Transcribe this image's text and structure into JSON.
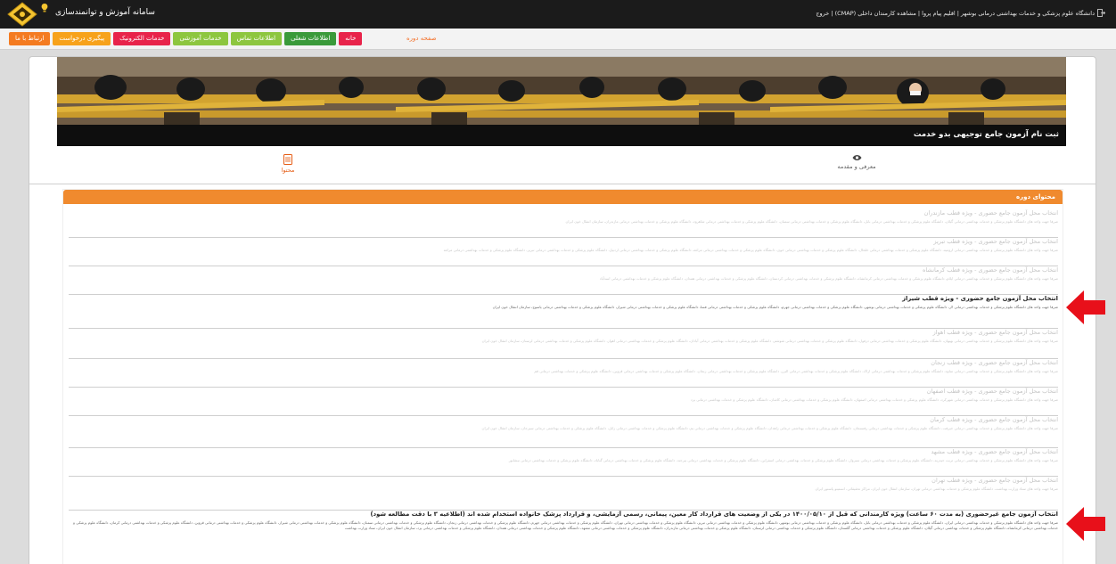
{
  "topbar": {
    "app_title": "سامانه آموزش و توانمندسازی",
    "user_info": "دانشگاه علوم پزشکی و خدمات بهداشتی درمانی بوشهر | اقلیم پیام پروا | مشاهده کارمندان داخلی (CMAP) | خروج"
  },
  "menu": {
    "buttons": [
      {
        "label": "ارتباط با ما",
        "color": "#f47b21"
      },
      {
        "label": "پیگیری درخواست",
        "color": "#f7a21b"
      },
      {
        "label": "خدمات الکترونیک",
        "color": "#e8234a"
      },
      {
        "label": "خدمات آموزشی",
        "color": "#8dc63f"
      },
      {
        "label": "اطلاعات تماس",
        "color": "#8dc63f"
      },
      {
        "label": "اطلاعات شغلی",
        "color": "#3a9a3a"
      },
      {
        "label": "خانه",
        "color": "#e8234a"
      }
    ],
    "page_label": "صفحه دوره"
  },
  "hero": {
    "caption": "ثبت نام آزمون جامع توجیهی بدو خدمت"
  },
  "tabs": {
    "content_label": "محتوا",
    "intro_label": "معرفی و مقدمه"
  },
  "panel": {
    "title": "محتوای دوره",
    "items": [
      {
        "title": "انتخاب محل آزمون جامع حضوری - ویژه قطب مازندران",
        "desc": "صرفا جهت واحد های دانشگاه علوم پزشکی و خدمات بهداشتی درمانی گیلان، دانشگاه علوم پزشکی و خدمات بهداشتی درمانی بابل، دانشگاه علوم پزشکی و خدمات بهداشتی درمانی سمنان، دانشگاه علوم پزشکی و خدمات بهداشتی درمانی شاهرود، دانشگاه علوم پزشکی و خدمات بهداشتی درمانی مازندران، سازمان انتقال خون ایران"
      },
      {
        "title": "انتخاب محل آزمون جامع حضوری - ویژه قطب تبریز",
        "desc": "صرفا جهت واحد های دانشگاه علوم پزشکی و خدمات بهداشتی درمانی ارومیه، دانشگاه علوم پزشکی و خدمات بهداشتی درمانی خلخال، دانشگاه علوم پزشکی و خدمات بهداشتی درمانی خوی، دانشگاه علوم پزشکی و خدمات بهداشتی درمانی مراغه، دانشگاه علوم پزشکی و خدمات بهداشتی درمانی اردبیل، دانشگاه علوم پزشکی و خدمات بهداشتی درمانی تبریز، دانشگاه علوم پزشکی و خدمات بهداشتی درمانی مراغه"
      },
      {
        "title": "انتخاب محل آزمون جامع حضوری - ویژه قطب کرمانشاه",
        "desc": "صرفا جهت واحد های دانشگاه علوم پزشکی و خدمات بهداشتی درمانی ایلام، دانشگاه علوم پزشکی و خدمات بهداشتی درمانی کرمانشاه، دانشگاه علوم پزشکی و خدمات بهداشتی درمانی کردستان، دانشگاه علوم پزشکی و خدمات بهداشتی درمانی همدان، دانشگاه علوم پزشکی و خدمات بهداشتی درمانی اسدآباد"
      },
      {
        "title": "انتخاب محل آزمون جامع حضوری - ویژه قطب شیراز",
        "desc": "صرفا جهت واحد های دانشگاه علوم پزشکی و خدمات بهداشتی درمانی لار، دانشگاه علوم پزشکی و خدمات بهداشتی درمانی بوشهر، دانشگاه علوم پزشکی و خدمات بهداشتی درمانی جهرم، دانشگاه علوم پزشکی و خدمات بهداشتی درمانی فسا، دانشگاه علوم پزشکی و خدمات بهداشتی درمانی شیراز، دانشگاه علوم پزشکی و خدمات بهداشتی درمانی یاسوج، سازمان انتقال خون ایران"
      },
      {
        "title": "انتخاب محل آزمون جامع حضوری - ویژه قطب اهواز",
        "desc": "صرفا جهت واحد های دانشگاه علوم پزشکی و خدمات بهداشتی درمانی بهبهان، دانشگاه علوم پزشکی و خدمات بهداشتی درمانی دزفول، دانشگاه علوم پزشکی و خدمات بهداشتی درمانی شوشتر، دانشگاه علوم پزشکی و خدمات بهداشتی درمانی آبادان، دانشگاه علوم پزشکی و خدمات بهداشتی درمانی اهواز، دانشگاه علوم پزشکی و خدمات بهداشتی درمانی لرستان، سازمان انتقال خون ایران"
      },
      {
        "title": "انتخاب محل آزمون جامع حضوری - ویژه قطب زنجان",
        "desc": "صرفا جهت واحد های دانشگاه علوم پزشکی و خدمات بهداشتی درمانی ساوه، دانشگاه علوم پزشکی و خدمات بهداشتی درمانی اراک، دانشگاه علوم پزشکی و خدمات بهداشتی درمانی البرز، دانشگاه علوم پزشکی و خدمات بهداشتی درمانی زنجان، دانشگاه علوم پزشکی و خدمات بهداشتی درمانی قزوین، دانشگاه علوم پزشکی و خدمات بهداشتی درمانی قم"
      },
      {
        "title": "انتخاب محل آزمون جامع حضوری - ویژه قطب اصفهان",
        "desc": "صرفا جهت واحد های دانشگاه علوم پزشکی و خدمات بهداشتی درمانی شهرکرد، دانشگاه علوم پزشکی و خدمات بهداشتی درمانی اصفهان، دانشگاه علوم پزشکی و خدمات بهداشتی درمانی کاشان، دانشگاه علوم پزشکی و خدمات بهداشتی درمانی یزد"
      },
      {
        "title": "انتخاب محل آزمون جامع حضوری - ویژه قطب کرمان",
        "desc": "صرفا جهت واحد های دانشگاه علوم پزشکی و خدمات بهداشتی درمانی جیرفت، دانشگاه علوم پزشکی و خدمات بهداشتی درمانی رفسنجان، دانشگاه علوم پزشکی و خدمات بهداشتی درمانی زاهدان، دانشگاه علوم پزشکی و خدمات بهداشتی درمانی بم، دانشگاه علوم پزشکی و خدمات بهداشتی درمانی زابل، دانشگاه علوم پزشکی و خدمات بهداشتی درمانی سیرجان، سازمان انتقال خون ایران"
      },
      {
        "title": "انتخاب محل آزمون جامع حضوری - ویژه قطب مشهد",
        "desc": "صرفا جهت واحد های دانشگاه علوم پزشکی و خدمات بهداشتی درمانی تربت حیدریه، دانشگاه علوم پزشکی و خدمات بهداشتی درمانی سبزوار، دانشگاه علوم پزشکی و خدمات بهداشتی درمانی اسفراین، دانشگاه علوم پزشکی و خدمات بهداشتی درمانی بیرجند، دانشگاه علوم پزشکی و خدمات بهداشتی درمانی گناباد، دانشگاه علوم پزشکی و خدمات بهداشتی درمانی نیشابور"
      },
      {
        "title": "انتخاب محل آزمون جامع حضوری - ویژه قطب تهران",
        "desc": "صرفا جهت واحد های ستاد وزارت بهداشت، دانشگاه علوم پزشکی و خدمات بهداشتی درمانی تهران، سازمان انتقال خون ایران، مراکز تحقیقاتی، انستیتو پاستور ایران"
      },
      {
        "title": "انتخاب آزمون جامع غیرحضوری (به مدت ۶۰ ساعت) ویژه کارمندانی که قبل از ۱۴۰۰/۰۵/۱۰ در یکی از وضعیت های قرارداد کار معین، پیمانی، رسمی آزمایشی، و قرارداد پزشک خانواده استخدام شده اند (اطلاعیه ۳ با دقت مطالعه شود)",
        "desc": "صرفا جهت واحد های دانشگاه علوم پزشکی و خدمات بهداشتی درمانی ایران، دانشگاه علوم پزشکی و خدمات بهداشتی درمانی بابل، دانشگاه علوم پزشکی و خدمات بهداشتی درمانی بوشهر، دانشگاه علوم پزشکی و خدمات بهداشتی درمانی تبریز، دانشگاه علوم پزشکی و خدمات بهداشتی درمانی تهران، دانشگاه علوم پزشکی و خدمات بهداشتی درمانی جهرم، دانشگاه علوم پزشکی و خدمات بهداشتی درمانی زنجان، دانشگاه علوم پزشکی و خدمات بهداشتی درمانی سمنان، دانشگاه علوم پزشکی و خدمات بهداشتی درمانی شیراز، دانشگاه علوم پزشکی و خدمات بهداشتی درمانی قزوین، دانشگاه علوم پزشکی و خدمات بهداشتی درمانی کرمان، دانشگاه علوم پزشکی و خدمات بهداشتی درمانی کرمانشاه، دانشگاه علوم پزشکی و خدمات بهداشتی درمانی گیلان، دانشگاه علوم پزشکی و خدمات بهداشتی درمانی گلستان، دانشگاه علوم پزشکی و خدمات بهداشتی درمانی لرستان، دانشگاه علوم پزشکی و خدمات بهداشتی درمانی مازندران، دانشگاه علوم پزشکی و خدمات بهداشتی درمانی مشهد، دانشگاه علوم پزشکی و خدمات بهداشتی درمانی همدان، دانشگاه علوم پزشکی و خدمات بهداشتی درمانی یزد، سازمان انتقال خون ایران، ستاد وزارت بهداشت"
      }
    ]
  },
  "colors": {
    "accent": "#f08a2e",
    "arrow": "#e8101a",
    "active_tab": "#e55b13"
  }
}
